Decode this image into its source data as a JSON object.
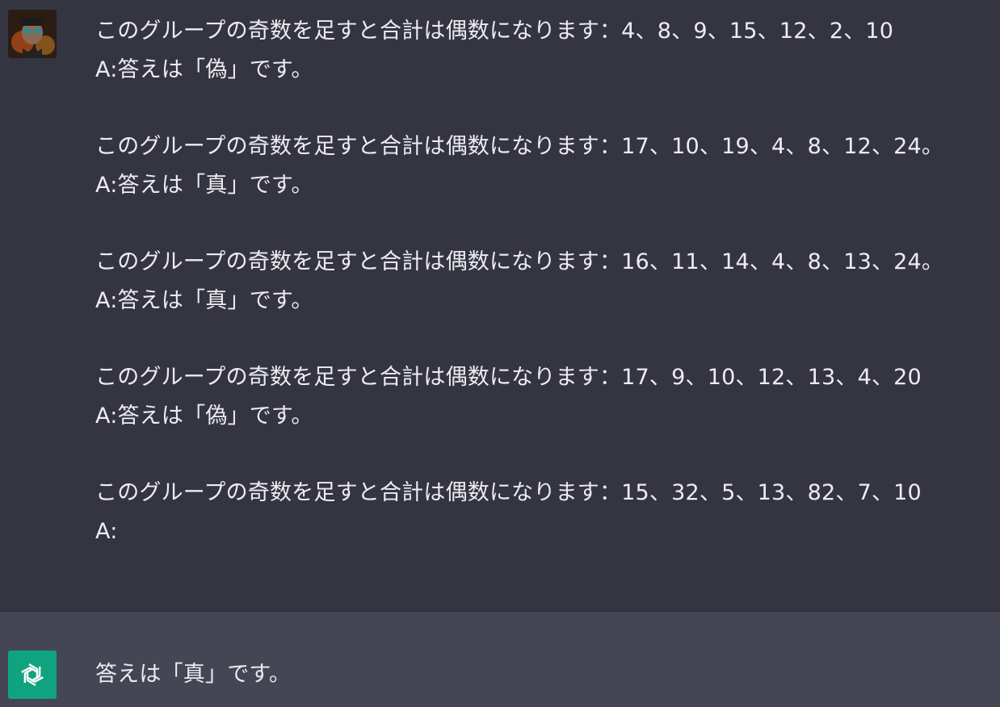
{
  "conversation": {
    "user": {
      "avatar_icon": "user-avatar-icon",
      "blocks": [
        {
          "question": "このグループの奇数を足すと合計は偶数になります：4、8、9、15、12、2、10",
          "answer": "A:答えは「偽」です。"
        },
        {
          "question": "このグループの奇数を足すと合計は偶数になります：17、10、19、4、8、12、24。",
          "answer": "A:答えは「真」です。"
        },
        {
          "question": "このグループの奇数を足すと合計は偶数になります：16、11、14、4、8、13、24。",
          "answer": "A:答えは「真」です。"
        },
        {
          "question": "このグループの奇数を足すと合計は偶数になります：17、9、10、12、13、4、20",
          "answer": "A:答えは「偽」です。"
        },
        {
          "question": "このグループの奇数を足すと合計は偶数になります：15、32、5、13、82、7、10",
          "answer": "A:"
        }
      ]
    },
    "assistant": {
      "avatar_icon": "openai-logo-icon",
      "text": "答えは「真」です。"
    }
  },
  "colors": {
    "user_bg": "#343541",
    "assistant_bg": "#444654",
    "text": "#ececf1",
    "bot_avatar": "#10a37f"
  }
}
